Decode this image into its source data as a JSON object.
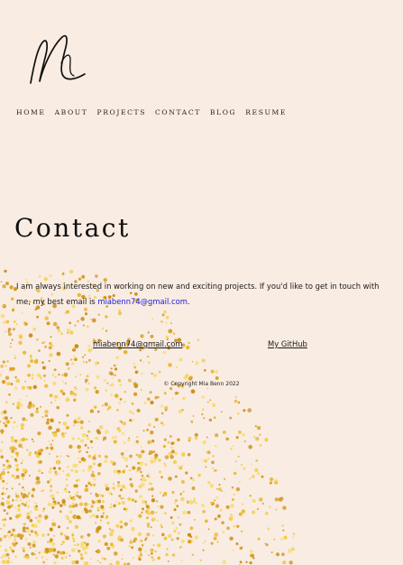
{
  "logo": {
    "icon": "signature-logo-icon"
  },
  "nav": {
    "items": [
      "HOME",
      "ABOUT",
      "PROJECTS",
      "CONTACT",
      "BLOG",
      "RESUME"
    ]
  },
  "page": {
    "title": "Contact",
    "intro_text": "I am always interested in working on new and exciting projects. If you'd like to get in touch with me, my best email is ",
    "intro_email": "miabenn74@gmail.com",
    "intro_end": "."
  },
  "footer": {
    "email_link": "miabenn74@gmail.com",
    "github_link": "My GitHub",
    "copyright": "© Copyright Mia Benn 2022"
  },
  "colors": {
    "background": "#f9ece3",
    "link": "#1a1ad8",
    "glitter": [
      "#e9b72c",
      "#d49a1c",
      "#f3cf4a",
      "#c98d15",
      "#f7dc6a"
    ]
  }
}
